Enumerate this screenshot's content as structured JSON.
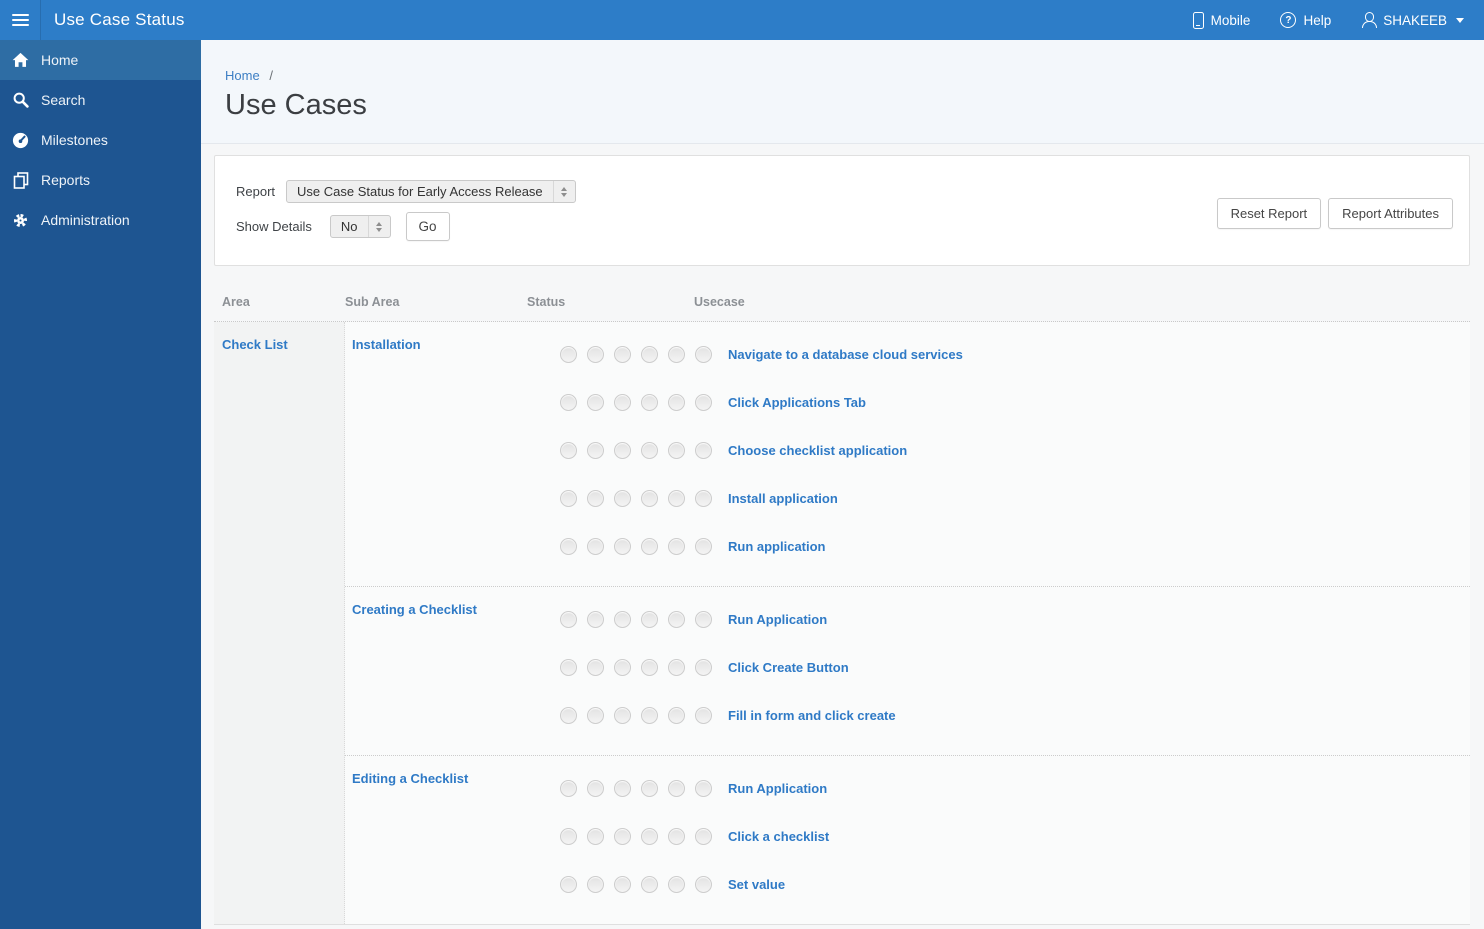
{
  "topbar": {
    "title": "Use Case Status",
    "menu_icon": "hamburger-icon",
    "mobile_label": "Mobile",
    "mobile_icon": "phone-icon",
    "help_label": "Help",
    "help_icon": "question-circle-icon",
    "help_glyph": "?",
    "user_name": "SHAKEEB",
    "user_icon": "person-icon",
    "user_caret_icon": "caret-down-icon"
  },
  "sidebar": {
    "items": [
      {
        "label": "Home",
        "icon": "home-icon",
        "active": true
      },
      {
        "label": "Search",
        "icon": "search-icon",
        "active": false
      },
      {
        "label": "Milestones",
        "icon": "gauge-icon",
        "active": false
      },
      {
        "label": "Reports",
        "icon": "pages-icon",
        "active": false
      },
      {
        "label": "Administration",
        "icon": "gear-icon",
        "active": false
      }
    ]
  },
  "breadcrumb": {
    "home": "Home",
    "separator": "/"
  },
  "page": {
    "title": "Use Cases"
  },
  "report_form": {
    "report_label": "Report",
    "report_value": "Use Case Status for Early Access Release",
    "show_details_label": "Show Details",
    "show_details_value": "No",
    "go_label": "Go",
    "reset_label": "Reset Report",
    "attributes_label": "Report Attributes"
  },
  "table": {
    "headers": [
      "Area",
      "Sub Area",
      "Status",
      "Usecase"
    ],
    "status_circle_count": 6,
    "areas": [
      {
        "name": "Check List",
        "sub_areas": [
          {
            "name": "Installation",
            "use_cases": [
              "Navigate to a database cloud services",
              "Click Applications Tab",
              "Choose checklist application",
              "Install application",
              "Run application"
            ]
          },
          {
            "name": "Creating a Checklist",
            "use_cases": [
              "Run Application",
              "Click Create Button",
              "Fill in form and click create"
            ]
          },
          {
            "name": "Editing a Checklist",
            "use_cases": [
              "Run Application",
              "Click a checklist",
              "Set value"
            ]
          }
        ]
      }
    ]
  },
  "colors": {
    "topbar_bg": "#2d7dc8",
    "sidebar_bg": "#1e5591",
    "sidebar_active_bg": "#2e6da4",
    "link_blue": "#2f7ac6",
    "title_region_bg": "#f3f7fb",
    "page_bg": "#f6f7f8"
  }
}
